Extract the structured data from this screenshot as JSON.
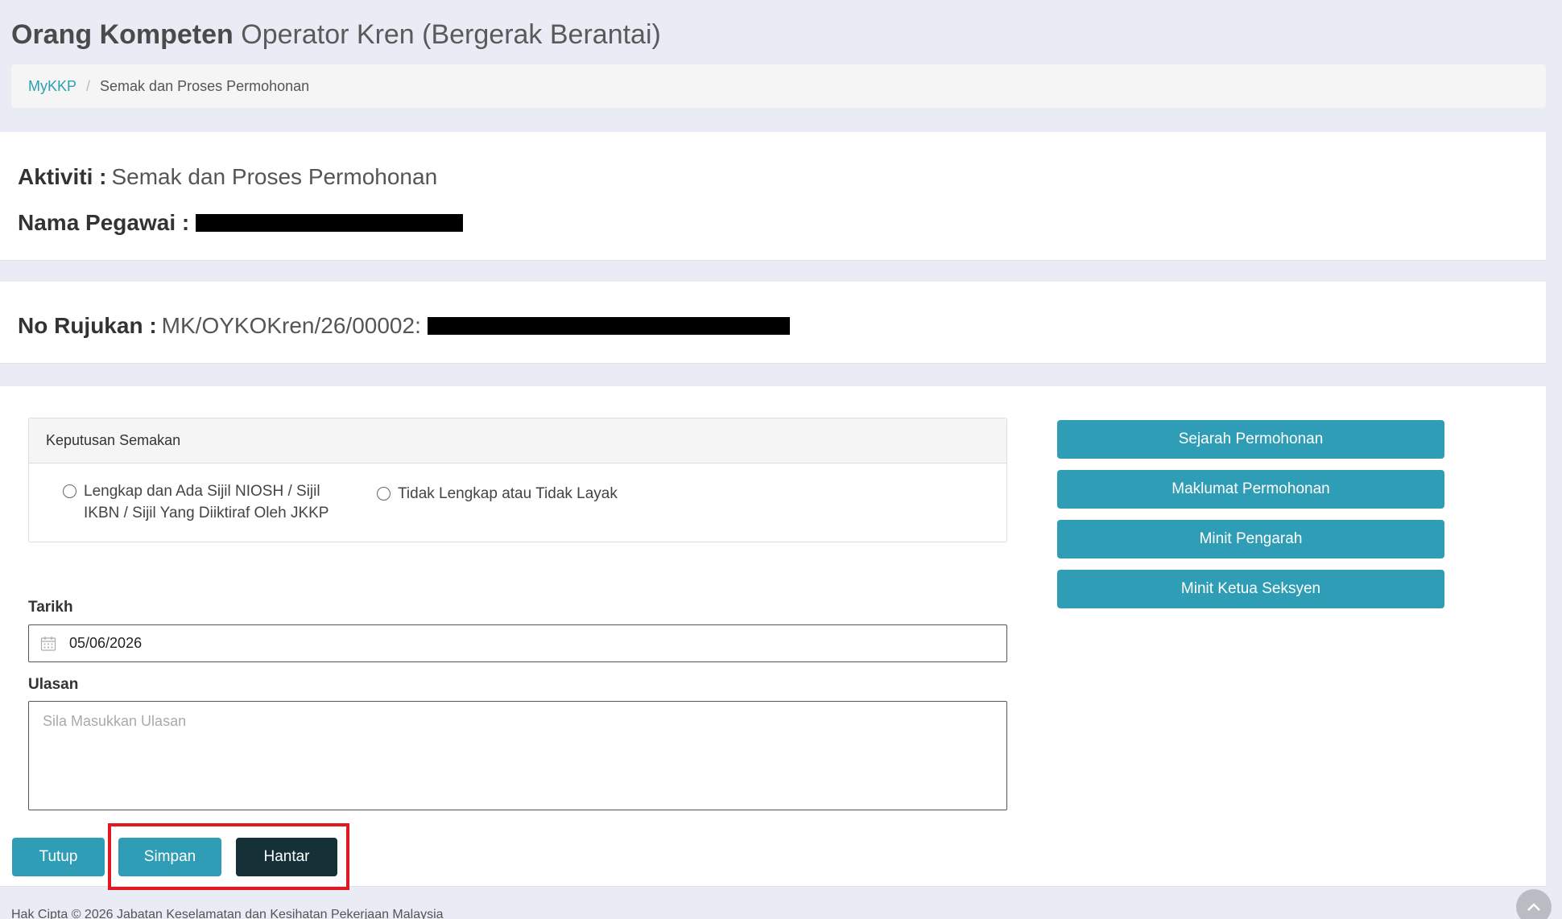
{
  "header": {
    "title_bold": "Orang Kompeten",
    "title_light": "Operator Kren (Bergerak Berantai)"
  },
  "breadcrumb": {
    "home": "MyKKP",
    "separator": "/",
    "current": "Semak dan Proses Permohonan"
  },
  "info": {
    "aktiviti_label": "Aktiviti :",
    "aktiviti_value": "Semak dan Proses Permohonan",
    "pegawai_label": "Nama Pegawai :",
    "rujukan_label": "No Rujukan :",
    "rujukan_value": "MK/OYKOKren/26/00002:"
  },
  "keputusan": {
    "title": "Keputusan Semakan",
    "option1_line1": "Lengkap dan Ada Sijil NIOSH / Sijil",
    "option1_line2": "IKBN / Sijil Yang Diiktiraf Oleh JKKP",
    "option2": "Tidak Lengkap atau Tidak Layak"
  },
  "side_buttons": {
    "sejarah": "Sejarah Permohonan",
    "maklumat": "Maklumat Permohonan",
    "minit_pengarah": "Minit Pengarah",
    "minit_ketua": "Minit Ketua Seksyen"
  },
  "form": {
    "tarikh_label": "Tarikh",
    "tarikh_value": "05/06/2026",
    "ulasan_label": "Ulasan",
    "ulasan_placeholder": "Sila Masukkan Ulasan"
  },
  "actions": {
    "tutup": "Tutup",
    "simpan": "Simpan",
    "hantar": "Hantar"
  },
  "footer": {
    "text": "Hak Cipta © 2026 Jabatan Keselamatan dan Kesihatan Pekerjaan Malaysia"
  },
  "colors": {
    "accent": "#2f9db5",
    "dark_button": "#163038",
    "highlight": "#e3171f"
  }
}
